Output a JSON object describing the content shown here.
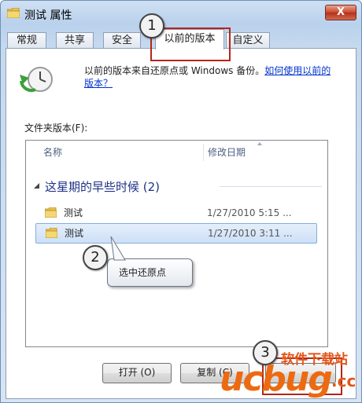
{
  "window": {
    "title": "测试 属性",
    "close_label": "X"
  },
  "tabs": [
    {
      "label": "常规"
    },
    {
      "label": "共享"
    },
    {
      "label": "安全"
    },
    {
      "label": "以前的版本"
    },
    {
      "label": "自定义"
    }
  ],
  "info": {
    "text": "以前的版本来自还原点或 Windows 备份。",
    "link": "如何使用以前的版本？"
  },
  "file_versions": {
    "label": "文件夹版本(F):",
    "columns": {
      "name": "名称",
      "date": "修改日期"
    },
    "group": {
      "title": "这星期的早些时候 (2)"
    },
    "rows": [
      {
        "name": "测试",
        "date": "1/27/2010 5:15 ..."
      },
      {
        "name": "测试",
        "date": "1/27/2010 3:11 ..."
      }
    ]
  },
  "annotations": {
    "step1": "1",
    "step2": "2",
    "step3": "3",
    "tooltip": "选中还原点"
  },
  "buttons": {
    "open": "打开 (O)",
    "copy": "复制 (C)"
  },
  "watermark": {
    "logo": "ucbug",
    "domain": ".cc",
    "site": "软件下载站"
  },
  "colors": {
    "highlight_red": "#b5251b",
    "link_blue": "#0033cc",
    "group_blue": "#1e3287",
    "watermark_orange": "#ec6a12"
  }
}
